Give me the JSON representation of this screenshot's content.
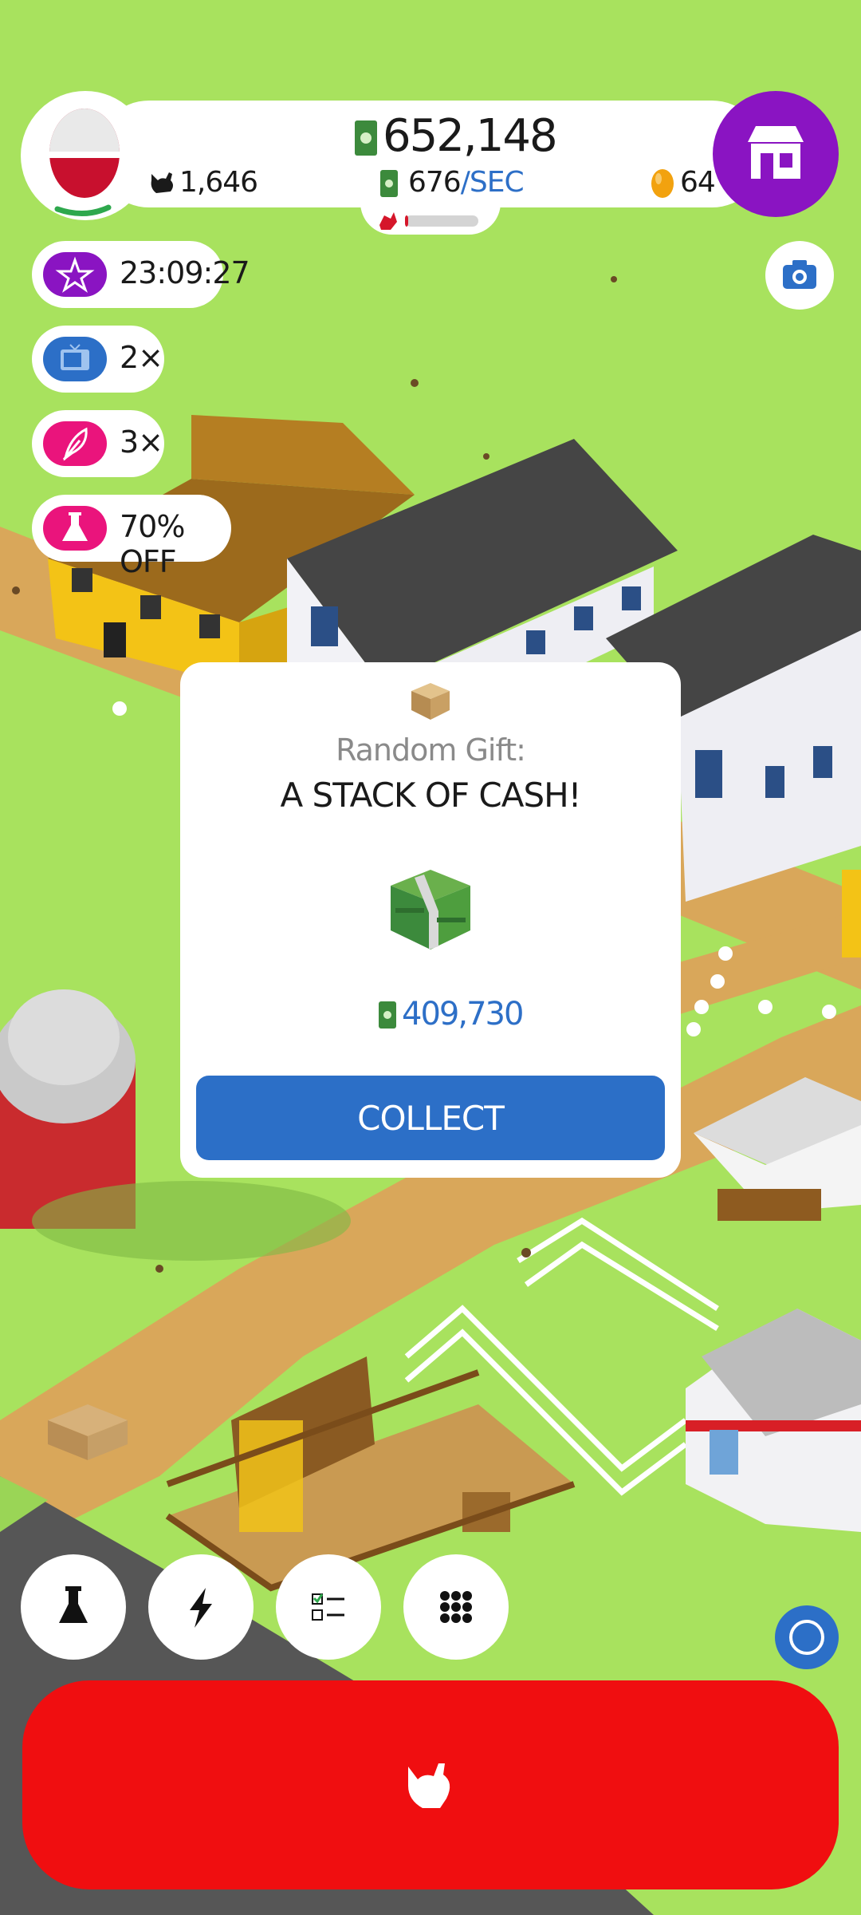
{
  "hud": {
    "cash": "652,148",
    "rate_value": "676",
    "rate_unit": "/SEC",
    "chickens": "1,646",
    "eggs": "64",
    "hatchery_fill": 0.03
  },
  "boosts": {
    "timer": "23:09:27",
    "tv_multiplier": "2×",
    "feather_multiplier": "3×",
    "research_discount": "70% OFF"
  },
  "gift": {
    "subtitle": "Random Gift:",
    "title": "A STACK OF CASH!",
    "amount": "409,730",
    "collect_label": "COLLECT"
  },
  "colors": {
    "grass": "#a8e25e",
    "shop": "#8a14c2",
    "boost_purple": "#8a14c2",
    "boost_blue": "#2c6fc7",
    "boost_pink": "#ea147c",
    "collect": "#2c6fc7",
    "hatch": "#f00e10",
    "cash_green": "#3c8a3c"
  },
  "icons": {
    "shop": "store-icon",
    "camera": "camera-icon",
    "star": "star-icon",
    "tv": "tv-icon",
    "feather": "feather-icon",
    "flask": "flask-icon",
    "lightning": "lightning-icon",
    "checklist": "checklist-icon",
    "grid": "grid-icon",
    "chicken": "chicken-icon",
    "assistant": "circle-icon"
  }
}
